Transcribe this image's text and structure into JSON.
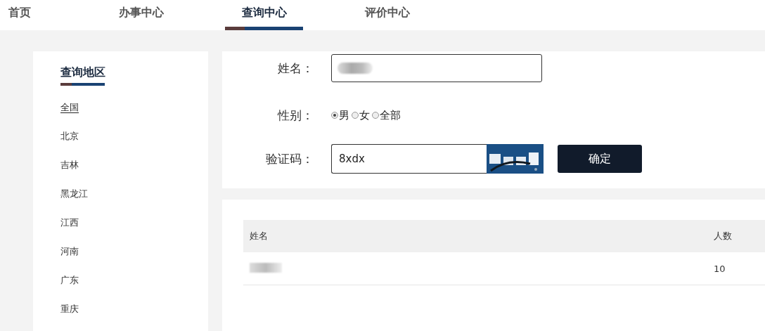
{
  "nav": [
    {
      "label": "首页",
      "selected": false
    },
    {
      "label": "办事中心",
      "selected": false
    },
    {
      "label": "查询中心",
      "selected": true
    },
    {
      "label": "评价中心",
      "selected": false
    }
  ],
  "sidebar": {
    "title": "查询地区",
    "items": [
      {
        "label": "全国",
        "selected": true
      },
      {
        "label": "北京",
        "selected": false
      },
      {
        "label": "吉林",
        "selected": false
      },
      {
        "label": "黑龙江",
        "selected": false
      },
      {
        "label": "江西",
        "selected": false
      },
      {
        "label": "河南",
        "selected": false
      },
      {
        "label": "广东",
        "selected": false
      },
      {
        "label": "重庆",
        "selected": false
      }
    ]
  },
  "form": {
    "fields": [
      {
        "kind": "text",
        "label": "姓名："
      },
      {
        "kind": "radio",
        "label": "性别：",
        "options": [
          {
            "label": "男",
            "selected": true
          },
          {
            "label": "女",
            "selected": false
          },
          {
            "label": "全部",
            "selected": false
          }
        ]
      },
      {
        "kind": "captcha",
        "label": "验证码：",
        "value": "8xdx"
      }
    ],
    "submit": "确定"
  },
  "table": {
    "columns": [
      "姓名",
      "人数"
    ],
    "rows": [
      {
        "cells": [
          {
            "kind": "redacted"
          },
          {
            "kind": "text",
            "text": "10"
          }
        ]
      }
    ]
  }
}
